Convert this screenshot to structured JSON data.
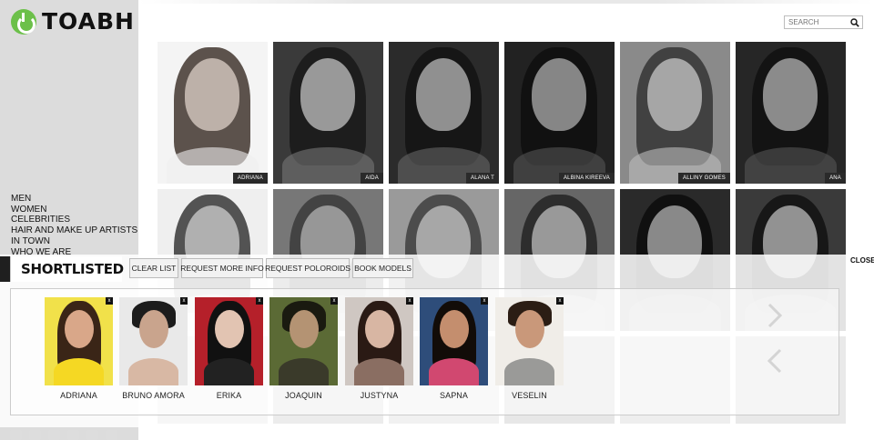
{
  "brand": {
    "name": "TOABH",
    "accent": "#6cc04a"
  },
  "nav": {
    "items": [
      "MEN",
      "WOMEN",
      "CELEBRITIES",
      "HAIR AND MAKE UP ARTISTS",
      "IN TOWN",
      "WHO WE ARE"
    ]
  },
  "search": {
    "placeholder": "SEARCH"
  },
  "models": {
    "row1": [
      "ADRIANA",
      "AIDA",
      "ALANA T",
      "ALBINA KIREEVA",
      "ALLINY GOMES",
      "ANA"
    ]
  },
  "shortlist": {
    "title": "SHORTLISTED",
    "buttons": [
      "CLEAR LIST",
      "REQUEST MORE INFO",
      "REQUEST POLOROIDS",
      "BOOK MODELS"
    ],
    "close_label": "CLOSE",
    "remove_glyph": "x",
    "items": [
      {
        "name": "ADRIANA",
        "bg": "#f1e14a",
        "body": "#f5d823"
      },
      {
        "name": "BRUNO AMORA",
        "bg": "#e9e9e9",
        "body": "#d8b8a4"
      },
      {
        "name": "ERIKA",
        "bg": "#b5202a",
        "body": "#222222"
      },
      {
        "name": "JOAQUIN",
        "bg": "#5b6a35",
        "body": "#3a3a2a"
      },
      {
        "name": "JUSTYNA",
        "bg": "#cfc7c2",
        "body": "#8a6e62"
      },
      {
        "name": "SAPNA",
        "bg": "#2e4d7a",
        "body": "#d14870"
      },
      {
        "name": "VESELIN",
        "bg": "#f0ede8",
        "body": "#9a9a98"
      }
    ]
  }
}
